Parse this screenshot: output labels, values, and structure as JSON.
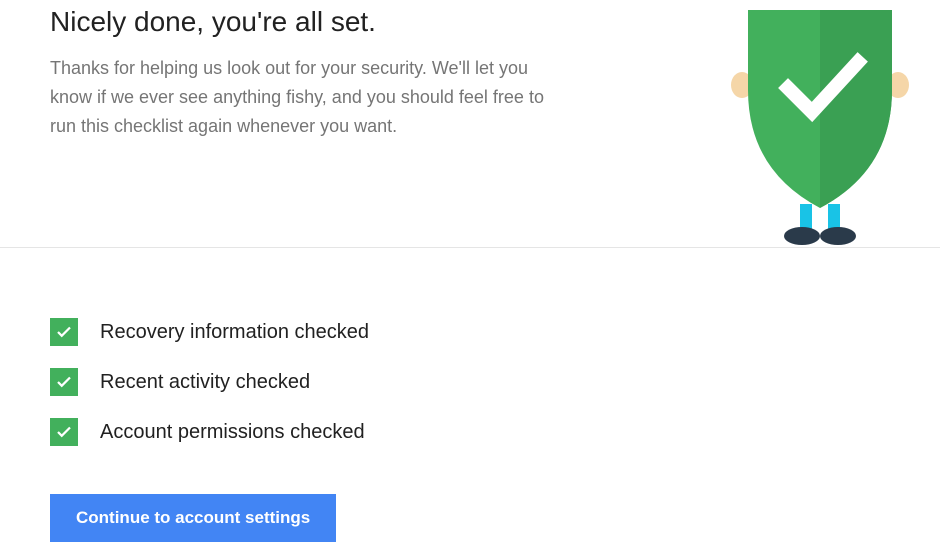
{
  "header": {
    "title": "Nicely done, you're all set.",
    "subtitle": "Thanks for helping us look out for your security. We'll let you know if we ever see anything fishy, and you should feel free to run this checklist again whenever you want."
  },
  "checklist": {
    "items": [
      {
        "label": "Recovery information checked"
      },
      {
        "label": "Recent activity checked"
      },
      {
        "label": "Account permissions checked"
      }
    ]
  },
  "cta": {
    "label": "Continue to account settings"
  },
  "colors": {
    "accent_green": "#42b05c",
    "button_blue": "#4285f4"
  }
}
